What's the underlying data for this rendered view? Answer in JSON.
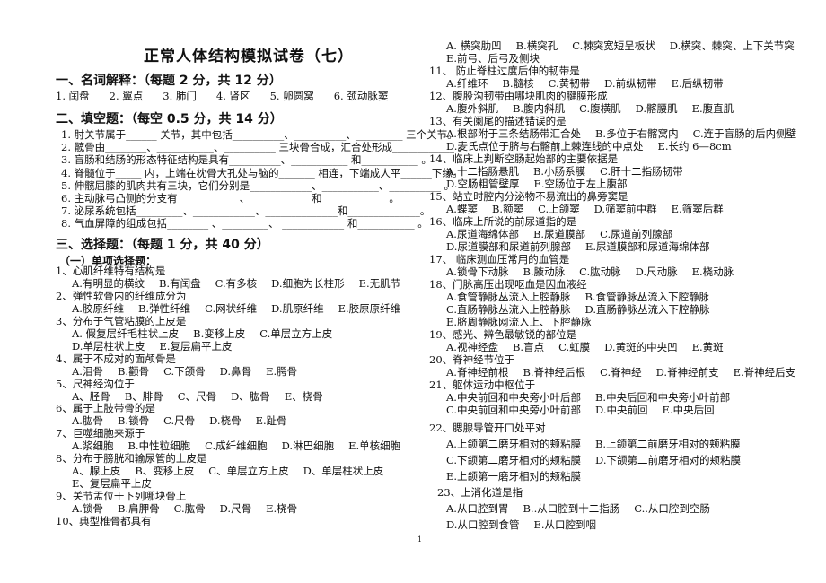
{
  "title": "正常人体结构模拟试卷（七）",
  "section1": {
    "heading": "一、名词解释：（每题 2 分，共 12 分）",
    "items": [
      "1. 闰盘",
      "2. 翼点",
      "3. 肺门",
      "4. 肾区",
      "5. 卵圆窝",
      "6. 颈动脉窦"
    ]
  },
  "section2": {
    "heading": "二、填空题：（每空 0.5 分，共 14 分）",
    "items": [
      "1.  肘关节属于______ 关节，其中包括__________、__________、_________ 三个关节。",
      "2.  髋骨由________、___________、__________ 三块骨合成，汇合处形成____________ 。",
      "3.  盲肠和结肠的形态特征结构是具有__________、___________ 和___________ 。",
      "4.  脊髓位于_____ 内，上端在枕骨大孔处与脑的_______ 相连，下端成人平______下缘。",
      "5.  伸髋屈膝的肌肉共有三块，它们分别是____________、___________、__________ 。",
      "6.  主动脉弓凸侧的分支有____________、____________和_____________。",
      "7.  泌尿系统包括_________、____________、______________和______________。",
      "8.  气血屏障的组成包括________ 、_________、    ____________ 和___________ 。"
    ]
  },
  "section3": {
    "heading": "三、选择题：（每题 1 分，共 40 分）",
    "subheading": "（一）单项选择题：",
    "questions": [
      {
        "stem": "1、心肌纤维特有结构是",
        "rows": [
          [
            "A.有明显的横纹",
            "B.有闰盘",
            "C.有多核",
            "D.细胞为长柱形",
            "E.无肌节"
          ]
        ]
      },
      {
        "stem": "2、弹性软骨内的纤维成分为",
        "rows": [
          [
            "A.胶原纤维",
            "B.弹性纤维",
            "C.网状纤维",
            "D.肌原纤维",
            "E.胶原原纤维"
          ]
        ]
      },
      {
        "stem": "3、分布于气管粘膜的上皮是",
        "rows": [
          [
            "A.  假复层纤毛柱状上皮",
            "B.变移上皮",
            "C.单层立方上皮"
          ],
          [
            "D.单层柱状上皮",
            "E.复层扁平上皮"
          ]
        ]
      },
      {
        "stem": "4、属于不成对的面颅骨是",
        "rows": [
          [
            "A.泪骨",
            "B.颧骨",
            "C.下颌骨",
            "D.鼻骨",
            "E.腭骨"
          ]
        ]
      },
      {
        "stem": "5、尺神经沟位于",
        "rows": [
          [
            "A、胫骨",
            "B、腓骨",
            "C、尺骨",
            "D、肱骨",
            "E、桡骨"
          ]
        ]
      },
      {
        "stem": "6、属于上肢带骨的是",
        "rows": [
          [
            "A.肱骨",
            "B.锁骨",
            "C.尺骨",
            "D.桡骨",
            "E.趾骨"
          ]
        ]
      },
      {
        "stem": "7、巨噬细胞来源于",
        "rows": [
          [
            "A.浆细胞",
            "B.中性粒细胞",
            "C.成纤维细胞",
            "D.淋巴细胞",
            "E.单核细胞"
          ]
        ]
      },
      {
        "stem": "8、分布于膀胱和输尿管的上皮是",
        "rows": [
          [
            "A、腺上皮",
            "B、变移上皮",
            "C、单层立方上皮",
            "D、单层柱状上皮"
          ],
          [
            "E、复层扁平上皮"
          ]
        ]
      },
      {
        "stem": "9、关节盂位于下列哪块骨上",
        "rows": [
          [
            "A.锁骨",
            "B.肩胛骨",
            "C.肱骨",
            "D.尺骨",
            "E.桡骨"
          ]
        ]
      },
      {
        "stem": "10、典型椎骨都具有",
        "rows": [
          [
            "A.  横突肋凹",
            "B.横突孔",
            "C.棘突宽短呈板状",
            "D.横突、棘突、上下关节突"
          ],
          [
            "E.前弓、后弓及侧块"
          ]
        ]
      },
      {
        "stem": "11、  防止脊柱过度后伸的韧带是",
        "rows": [
          [
            "A.纤维环",
            "B.髓核",
            "C.黄韧带",
            "D.前纵韧带",
            "E.后纵韧带"
          ]
        ]
      },
      {
        "stem": "12、腹股沟韧带由哪块肌肉的腱膜形成",
        "rows": [
          [
            "A.腹外斜肌",
            "B.腹内斜肌",
            "C.腹横肌",
            "D.髂腰肌",
            "E.腹直肌"
          ]
        ]
      },
      {
        "stem": "13、有关阑尾的描述错误的是",
        "rows": [
          [
            "A.根部附于三条结肠带汇合处",
            "B.多位于右髂窝内",
            "C.连于盲肠的后内侧壁"
          ],
          [
            "D.麦氏点位于脐与右髂前上棘连线的中点处",
            "E.长约 6—8cm"
          ]
        ]
      },
      {
        "stem": "14、临床上判断空肠起始部的主要依据是",
        "rows": [
          [
            "A.十二指肠悬肌",
            "B.小肠系膜",
            "C.肝十二指肠韧带"
          ],
          [
            "D.空肠粗管壁厚",
            "E.空肠位于左上腹部"
          ]
        ]
      },
      {
        "stem": "15、站立时腔内分泌物不易流出的鼻旁窦是",
        "rows": [
          [
            "A.蝶窦",
            "B.额窦",
            "C.上颌窦",
            "D.筛窦前中群",
            "E.筛窦后群"
          ]
        ]
      },
      {
        "stem": "16、临床上所说的前尿道指的是",
        "rows": [
          [
            "A.尿道海绵体部",
            "B.尿道膜部",
            "C.尿道前列腺部"
          ],
          [
            "D.尿道膜部和尿道前列腺部",
            "E.尿道膜部和尿道海绵体部"
          ]
        ]
      },
      {
        "stem": "17、  临床测血压常用的血管是",
        "rows": [
          [
            "A.锁骨下动脉",
            "B.腋动脉",
            "C.肱动脉",
            "D.尺动脉",
            "E.桡动脉"
          ]
        ]
      },
      {
        "stem": "18、门脉高压出现呕血是因血液经",
        "rows": [
          [
            "A.食管静脉丛流入上腔静脉",
            "B.食管静脉丛流入下腔静脉"
          ],
          [
            "C.直肠静脉丛流入上腔静脉",
            "D.直肠静脉丛流入下腔静脉"
          ],
          [
            "E.脐周静脉网流入上、下腔静脉"
          ]
        ]
      },
      {
        "stem": "19、感光、辨色最敏锐的部位是",
        "rows": [
          [
            "A.视神经盘",
            "B.盲点",
            "C.虹膜",
            "D.黄斑的中央凹",
            "E.黄斑"
          ]
        ]
      },
      {
        "stem": "20、脊神经节位于",
        "rows": [
          [
            "A.脊神经前根",
            "B.脊神经后根",
            "C.脊神经",
            "D.脊神经前支",
            "E.脊神经后支"
          ]
        ]
      },
      {
        "stem": "21、躯体运动中枢位于",
        "rows": [
          [
            "A.中央前回和中央旁小叶后部",
            "B.中央后回和中央旁小叶前部"
          ],
          [
            "C.中央前回和中央旁小叶前部",
            "D.中央前回",
            "E.中央后回"
          ]
        ]
      },
      {
        "stem": "22、腮腺导管开口处平对",
        "rows": [
          [
            "A.上颌第二磨牙相对的颊粘膜",
            "B.上颌第二前磨牙相对的颊粘膜"
          ],
          [
            "C.下颌第二磨牙相对的颊粘膜",
            "D.下颌第二前磨牙相对的颊粘膜"
          ],
          [
            "E.上颌第一磨牙相对的颊粘膜"
          ]
        ]
      },
      {
        "stem": "23、上消化道是指",
        "rows": [
          [
            "A.从口腔到胃",
            "B..从口腔到十二指肠",
            "C..从口腔到空肠"
          ],
          [
            "D.从口腔到食管",
            "E.从口腔到咽"
          ]
        ]
      }
    ]
  },
  "page_number": "1"
}
